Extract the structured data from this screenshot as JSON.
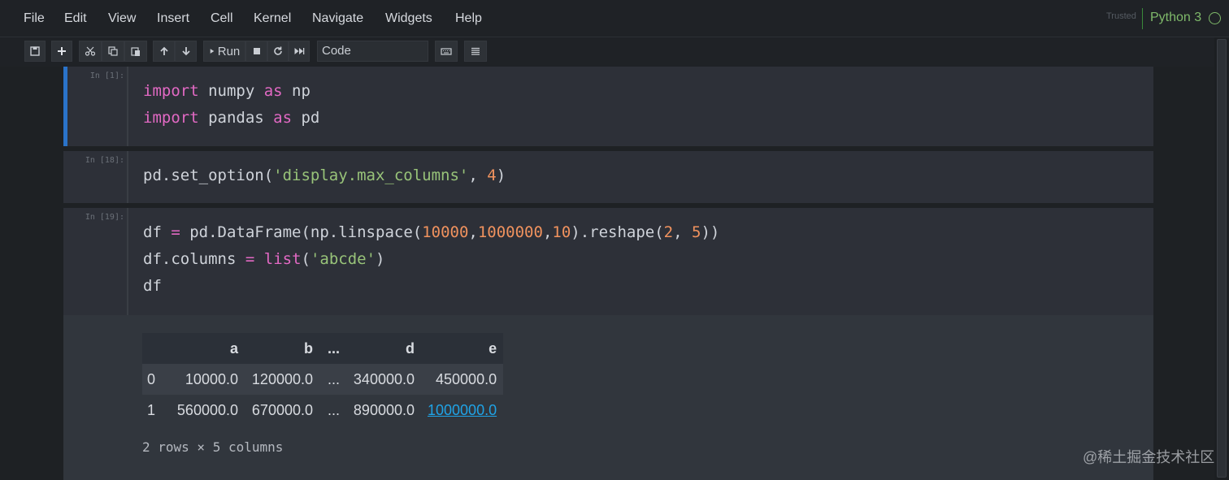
{
  "menubar": {
    "items": [
      "File",
      "Edit",
      "View",
      "Insert",
      "Cell",
      "Kernel",
      "Navigate",
      "Widgets",
      "Help"
    ],
    "trusted": "Trusted",
    "kernel": "Python 3"
  },
  "toolbar": {
    "run_label": "Run",
    "cell_type": "Code"
  },
  "cells": [
    {
      "prompt": "In [1]:",
      "lines": [
        "import numpy as np",
        "import pandas as pd"
      ]
    },
    {
      "prompt": "In [18]:",
      "lines": [
        "pd.set_option('display.max_columns', 4)"
      ]
    },
    {
      "prompt": "In [19]:",
      "lines": [
        "df = pd.DataFrame(np.linspace(10000,1000000,10).reshape(2, 5))",
        "df.columns = list('abcde')",
        "df"
      ]
    }
  ],
  "output": {
    "columns": [
      "",
      "a",
      "b",
      "...",
      "d",
      "e"
    ],
    "rows": [
      [
        "0",
        "10000.0",
        "120000.0",
        "...",
        "340000.0",
        "450000.0"
      ],
      [
        "1",
        "560000.0",
        "670000.0",
        "...",
        "890000.0",
        "1000000.0"
      ]
    ],
    "shape_text": "2 rows × 5 columns"
  },
  "watermark": "@稀土掘金技术社区",
  "colors": {
    "background": "#1e2124",
    "cell_background": "#2d3038",
    "selected_border": "#2a73c9",
    "keyword": "#e269c4",
    "string": "#98c379",
    "number": "#f0925e",
    "kernel": "#7fb96a",
    "link": "#1fa3e6"
  }
}
